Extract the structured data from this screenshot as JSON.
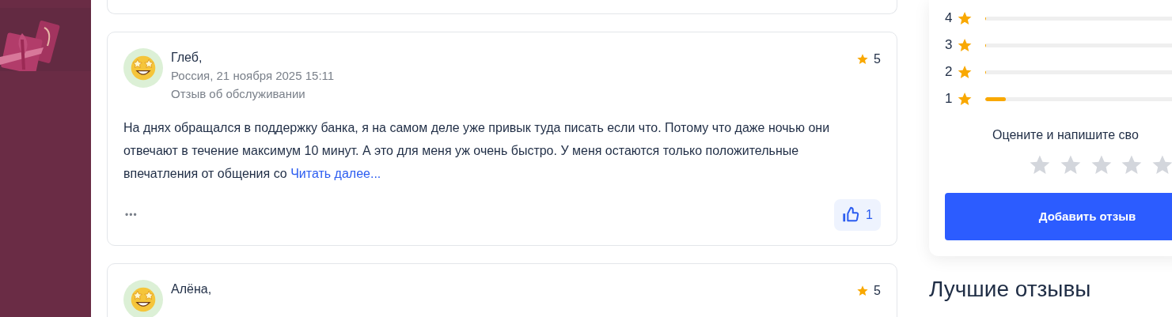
{
  "reviews": [
    {
      "author": "Глеб,",
      "meta": "Россия, 21 ноября 2025 15:11",
      "category": "Отзыв об обслуживании",
      "rating": "5",
      "text": "На днях обращался в поддержку банка, я на самом деле уже привык туда писать если что. Потому что даже ночью они отвечают в течение максимум 10 минут. А это для меня уж очень быстро. У меня остаются только положительные впечатления от общения со",
      "more": "Читать далее...",
      "menu": "•••",
      "likes": "1"
    },
    {
      "author": "Алёна,",
      "rating": "5"
    }
  ],
  "rating_summary": {
    "rows": [
      {
        "label": "4",
        "level": 0.004
      },
      {
        "label": "3",
        "level": 0.004
      },
      {
        "label": "2",
        "level": 0.004
      },
      {
        "label": "1",
        "level": 0.11
      }
    ],
    "prompt": "Оцените и напишите сво",
    "stars": 0,
    "button": "Добавить отзыв"
  },
  "best_reviews_heading": "Лучшие отзывы"
}
